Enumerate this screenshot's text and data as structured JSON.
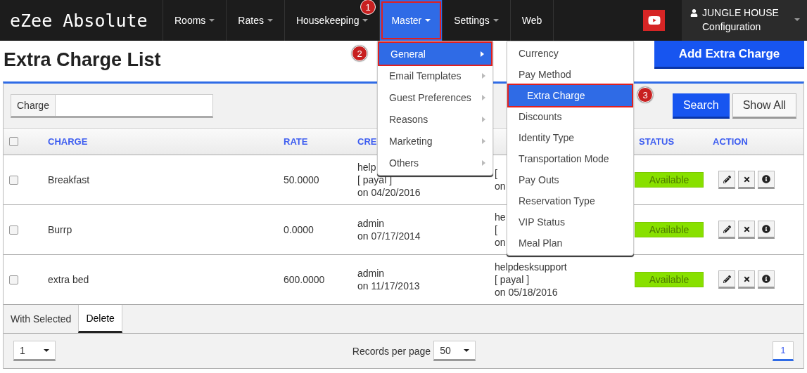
{
  "navbar": {
    "brand": "eZee Absolute",
    "items": [
      {
        "label": "Rooms",
        "caret": true,
        "selected": false
      },
      {
        "label": "Rates",
        "caret": true,
        "selected": false
      },
      {
        "label": "Housekeeping",
        "caret": true,
        "selected": false
      },
      {
        "label": "Master",
        "caret": true,
        "selected": true,
        "step": "1"
      },
      {
        "label": "Settings",
        "caret": true,
        "selected": false
      },
      {
        "label": "Web",
        "caret": false,
        "selected": false
      }
    ],
    "user": {
      "name": "JUNGLE HOUSE",
      "role": "Configuration"
    }
  },
  "page": {
    "title": "Extra Charge List",
    "add_button": "Add Extra Charge"
  },
  "filter": {
    "label": "Charge",
    "buttons": [
      {
        "label": "Search",
        "kind": "primary"
      },
      {
        "label": "Show All",
        "kind": "default"
      }
    ]
  },
  "table": {
    "columns": [
      {
        "kind": "checkbox",
        "checked": false
      },
      {
        "kind": "text",
        "label": "CHARGE"
      },
      {
        "kind": "text",
        "label": "RATE"
      },
      {
        "kind": "text",
        "label": "CRE"
      },
      {
        "kind": "text"
      },
      {
        "kind": "text",
        "label": "STATUS"
      },
      {
        "kind": "text",
        "label": "ACTION"
      }
    ],
    "rows": [
      {
        "checked": false,
        "charge": "Breakfast",
        "rate": "50.0000",
        "created": [
          "help",
          "[ payal ]",
          "on 04/20/2016"
        ],
        "modified": [
          "[",
          "on"
        ],
        "status": "Available"
      },
      {
        "checked": false,
        "charge": "Burrp",
        "rate": "0.0000",
        "created": [
          "admin",
          "on 07/17/2014"
        ],
        "modified": [
          "he",
          "[",
          "on"
        ],
        "status": "Available"
      },
      {
        "checked": false,
        "charge": "extra bed",
        "rate": "600.0000",
        "created": [
          "admin",
          "on 11/17/2013"
        ],
        "modified": [
          "helpdesksupport",
          "[ payal ]",
          "on 05/18/2016"
        ],
        "status": "Available"
      }
    ]
  },
  "bulk": {
    "label": "With Selected",
    "actions": [
      {
        "label": "Delete",
        "selected": true
      }
    ]
  },
  "pagination": {
    "page_select": "1",
    "records_label": "Records per page",
    "per_page": "50",
    "pages": [
      {
        "label": "1",
        "selected": true
      }
    ]
  },
  "menu": {
    "items": [
      {
        "label": "General",
        "submenu": true,
        "selected": true,
        "step": "2"
      },
      {
        "label": "Email Templates",
        "submenu": true,
        "selected": false
      },
      {
        "label": "Guest Preferences",
        "submenu": true,
        "selected": false
      },
      {
        "label": "Reasons",
        "submenu": true,
        "selected": false
      },
      {
        "label": "Marketing",
        "submenu": true,
        "selected": false
      },
      {
        "label": "Others",
        "submenu": true,
        "selected": false
      }
    ],
    "submenu": [
      {
        "label": "Currency",
        "selected": false
      },
      {
        "label": "Pay Method",
        "selected": false
      },
      {
        "label": "Extra Charge",
        "selected": true,
        "step": "3"
      },
      {
        "label": "Discounts",
        "selected": false
      },
      {
        "label": "Identity Type",
        "selected": false
      },
      {
        "label": "Transportation Mode",
        "selected": false
      },
      {
        "label": "Pay Outs",
        "selected": false
      },
      {
        "label": "Reservation Type",
        "selected": false
      },
      {
        "label": "VIP Status",
        "selected": false
      },
      {
        "label": "Meal Plan",
        "selected": false
      }
    ]
  }
}
